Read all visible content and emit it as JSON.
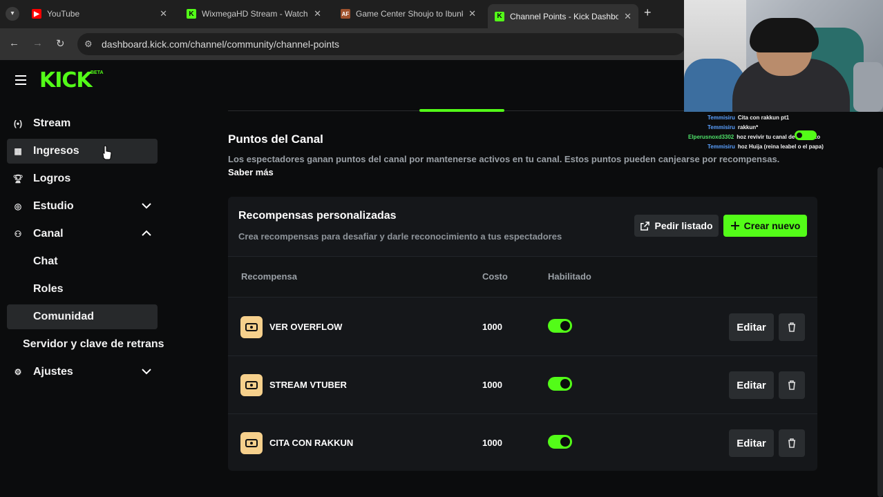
{
  "browser": {
    "tabs": [
      {
        "title": "YouTube",
        "favicon": "youtube-icon",
        "active": false
      },
      {
        "title": "WixmegaHD Stream - Watch Li",
        "favicon": "kick-icon",
        "active": false
      },
      {
        "title": "Game Center Shoujo to Ibunka",
        "favicon": "af-icon",
        "active": false
      },
      {
        "title": "Channel Points - Kick Dashboa",
        "favicon": "kick-icon",
        "active": true
      }
    ],
    "url": "dashboard.kick.com/channel/community/channel-points"
  },
  "sidebar": {
    "logo": "KICK",
    "beta": "BETA",
    "items": [
      {
        "label": "Stream",
        "icon": "broadcast-icon"
      },
      {
        "label": "Ingresos",
        "icon": "income-icon"
      },
      {
        "label": "Logros",
        "icon": "trophy-icon"
      },
      {
        "label": "Estudio",
        "icon": "studio-icon"
      },
      {
        "label": "Canal",
        "icon": "channel-icon"
      },
      {
        "label": "Chat"
      },
      {
        "label": "Roles"
      },
      {
        "label": "Comunidad"
      },
      {
        "label": "Servidor y clave de retrans"
      },
      {
        "label": "Ajustes",
        "icon": "gear-icon"
      }
    ]
  },
  "main": {
    "title": "Puntos del Canal",
    "description": "Los espectadores ganan puntos del canal por mantenerse activos en tu canal. Estos puntos pueden canjearse por recompensas.",
    "learn_more": "Saber más",
    "card": {
      "title": "Recompensas personalizadas",
      "description": "Crea recompensas para desafiar y darle reconocimiento a tus espectadores",
      "request_list": "Pedir listado",
      "create_new": "Crear nuevo",
      "columns": {
        "reward": "Recompensa",
        "cost": "Costo",
        "enabled": "Habilitado"
      },
      "rows": [
        {
          "name": "VER OVERFLOW",
          "cost": "1000",
          "enabled": true,
          "edit": "Editar"
        },
        {
          "name": "STREAM VTUBER",
          "cost": "1000",
          "enabled": true,
          "edit": "Editar"
        },
        {
          "name": "CITA CON RAKKUN",
          "cost": "1000",
          "enabled": true,
          "edit": "Editar"
        }
      ]
    }
  },
  "chat_overlay": [
    {
      "user": "Temmisiru",
      "message": "Cita con rakkun pt1"
    },
    {
      "user": "Temmisiru",
      "message": "rakkun*"
    },
    {
      "user": "Elperusnoxd3302",
      "message": "hoz revivir tu canal de comenzo"
    },
    {
      "user": "Temmisiru",
      "message": "hoz Huija (reina leabel o el papa)"
    }
  ],
  "colors": {
    "accent": "#53fc18",
    "background": "#0b0c0d",
    "card": "#15171a"
  }
}
